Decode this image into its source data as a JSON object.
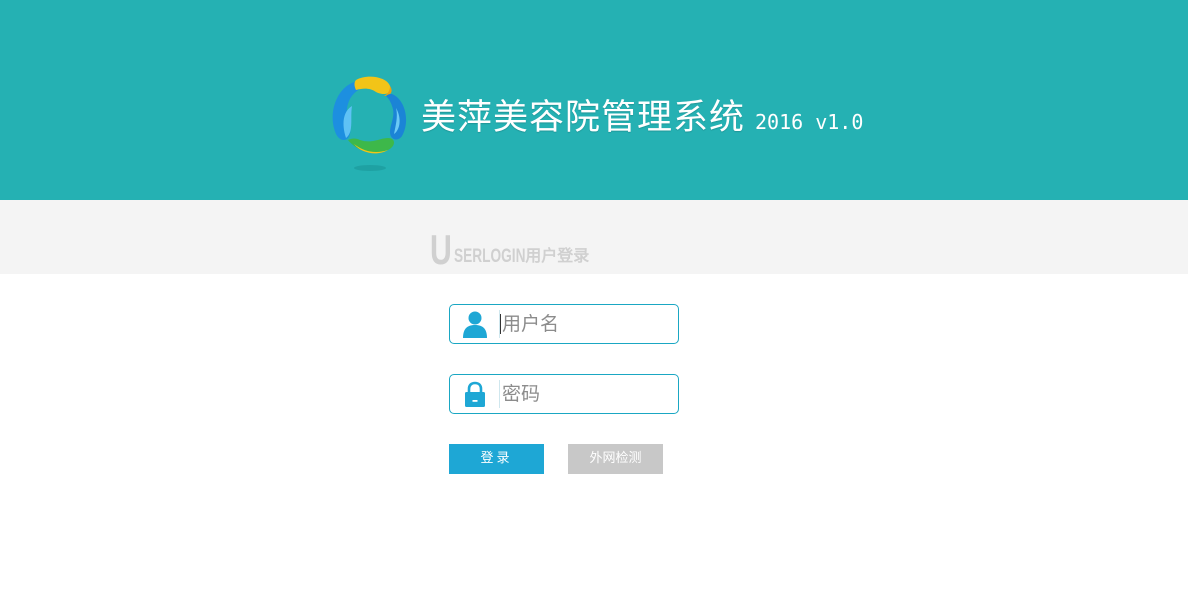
{
  "header": {
    "logo_icon": "colorful-swirl-logo-icon",
    "title": "美萍美容院管理系统",
    "version": "2016 v1.0",
    "bg_color": "#25b1b3"
  },
  "section": {
    "title_initial": "U",
    "title_rest": "SERLOGIN",
    "title_cn": "用户登录"
  },
  "login_form": {
    "username": {
      "icon": "user-icon",
      "value": "",
      "placeholder": "用户名"
    },
    "password": {
      "icon": "lock-icon",
      "value": "",
      "placeholder": "密码"
    },
    "login_button": "登录",
    "check_button": "外网检测",
    "accent_color": "#1ea7d5"
  }
}
